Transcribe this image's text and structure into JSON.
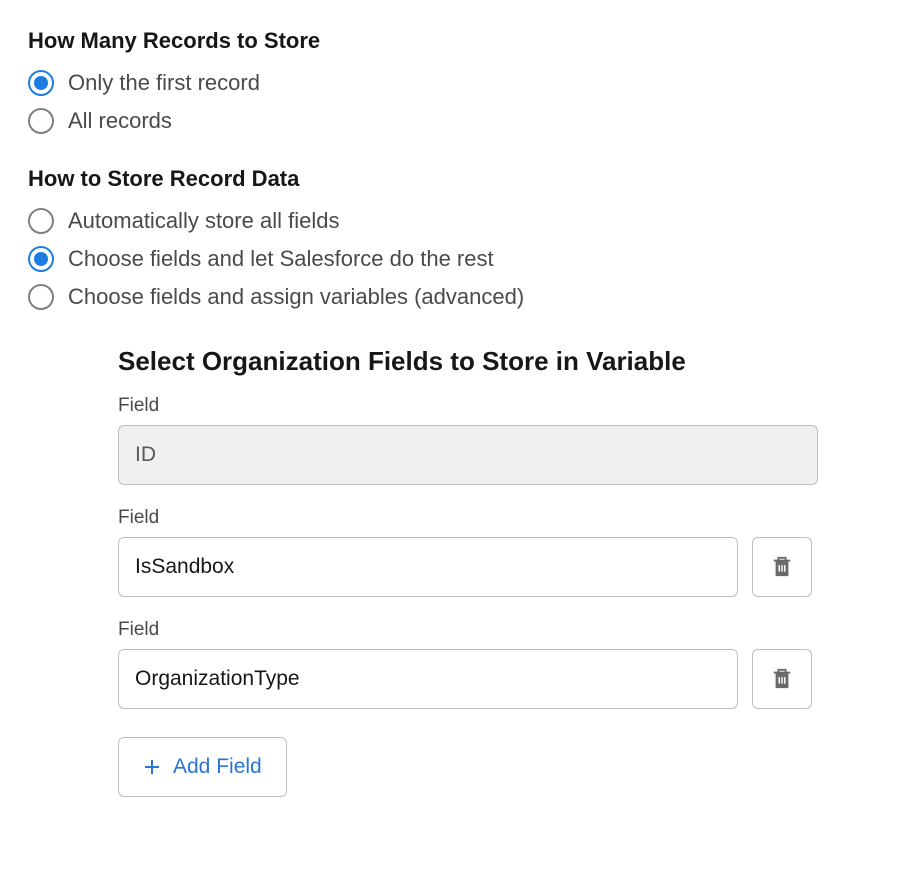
{
  "records_section": {
    "heading": "How Many Records to Store",
    "options": [
      {
        "label": "Only the first record",
        "selected": true
      },
      {
        "label": "All records",
        "selected": false
      }
    ]
  },
  "storage_section": {
    "heading": "How to Store Record Data",
    "options": [
      {
        "label": "Automatically store all fields",
        "selected": false
      },
      {
        "label": "Choose fields and let Salesforce do the rest",
        "selected": true
      },
      {
        "label": "Choose fields and assign variables (advanced)",
        "selected": false
      }
    ]
  },
  "fields_section": {
    "heading": "Select Organization Fields to Store in Variable",
    "field_label": "Field",
    "fields": [
      {
        "value": "ID",
        "locked": true
      },
      {
        "value": "IsSandbox",
        "locked": false
      },
      {
        "value": "OrganizationType",
        "locked": false
      }
    ],
    "add_label": "Add Field"
  }
}
